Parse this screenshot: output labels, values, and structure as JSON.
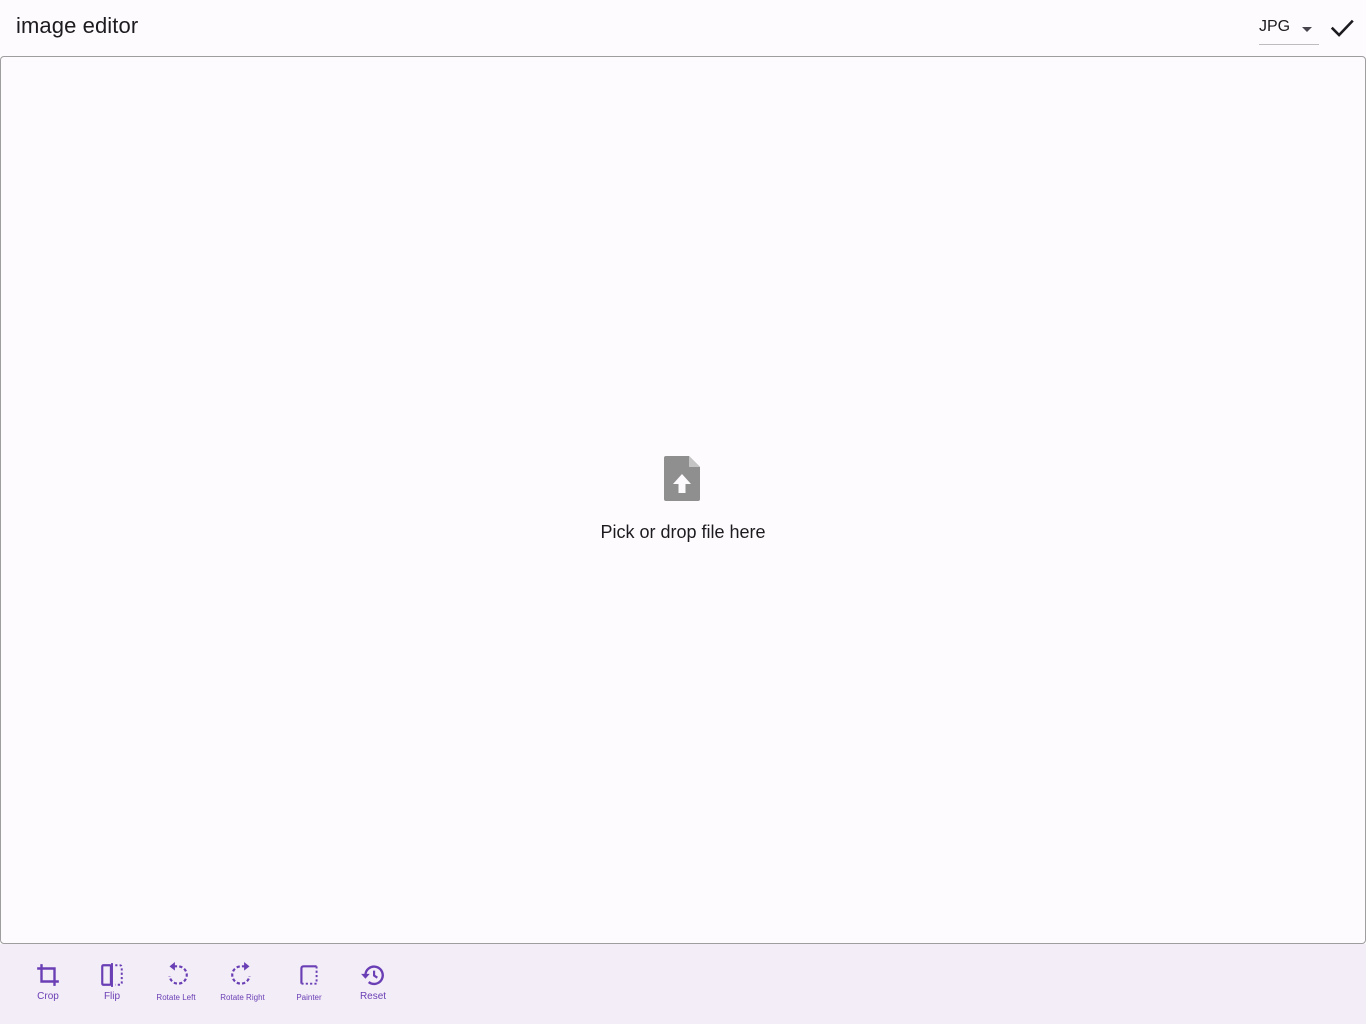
{
  "header": {
    "title": "image editor",
    "format_select": {
      "selected": "JPG"
    },
    "confirm_icon": "check-icon"
  },
  "drop_area": {
    "icon": "upload-file-icon",
    "text": "Pick or drop file here"
  },
  "toolbar": {
    "accent_color": "#6a3fb5",
    "items": [
      {
        "label": "Crop",
        "icon": "crop-icon"
      },
      {
        "label": "Flip",
        "icon": "flip-icon"
      },
      {
        "label": "Rotate Left",
        "icon": "rotate-left-icon"
      },
      {
        "label": "Rotate Right",
        "icon": "rotate-right-icon"
      },
      {
        "label": "Painter",
        "icon": "painter-icon"
      },
      {
        "label": "Reset",
        "icon": "history-icon"
      }
    ]
  }
}
